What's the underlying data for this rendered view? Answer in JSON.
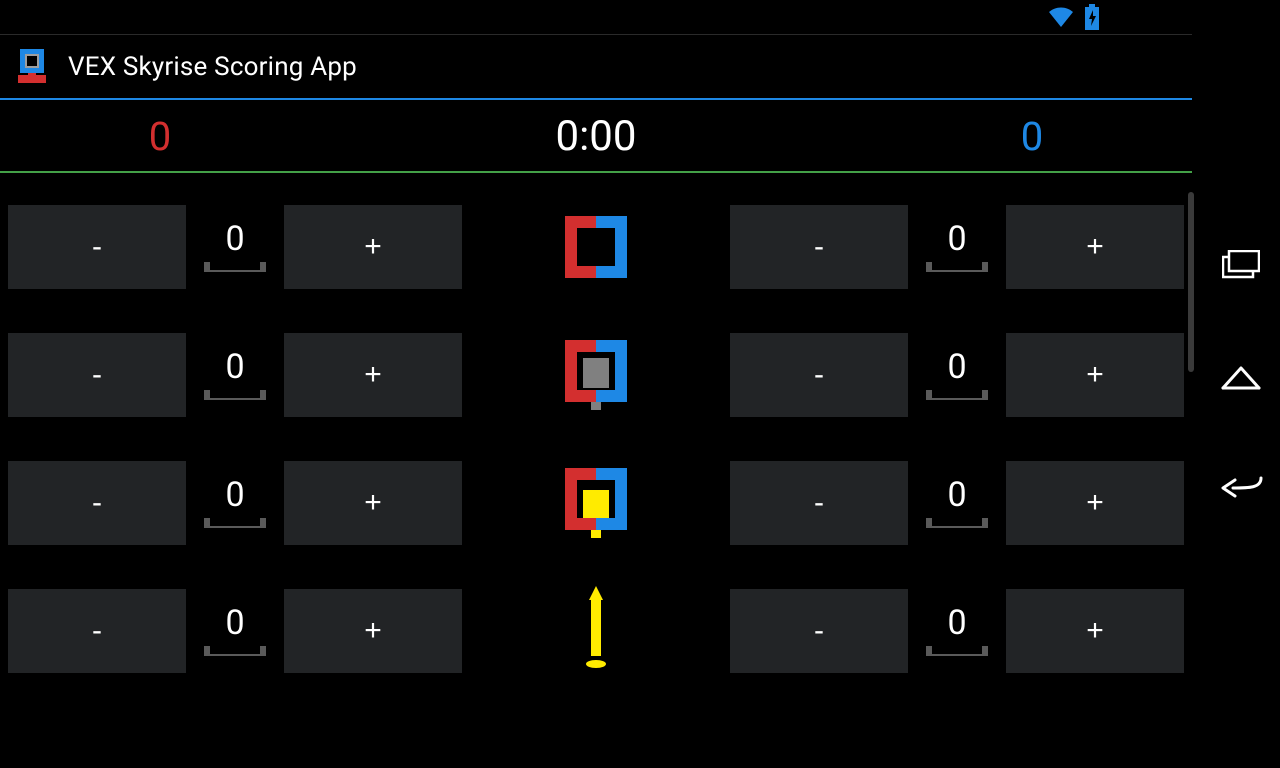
{
  "status": {
    "wifi": "wifi-icon",
    "battery": "battery-charging-icon"
  },
  "app": {
    "title": "VEX Skyrise Scoring App"
  },
  "scores": {
    "red": "0",
    "timer": "0:00",
    "blue": "0"
  },
  "buttons": {
    "minus": "-",
    "plus": "+"
  },
  "rows": [
    {
      "icon": "cube-empty",
      "left_count": "0",
      "right_count": "0"
    },
    {
      "icon": "cube-gray",
      "left_count": "0",
      "right_count": "0"
    },
    {
      "icon": "cube-yellow",
      "left_count": "0",
      "right_count": "0"
    },
    {
      "icon": "skyrise",
      "left_count": "0",
      "right_count": "0"
    }
  ]
}
